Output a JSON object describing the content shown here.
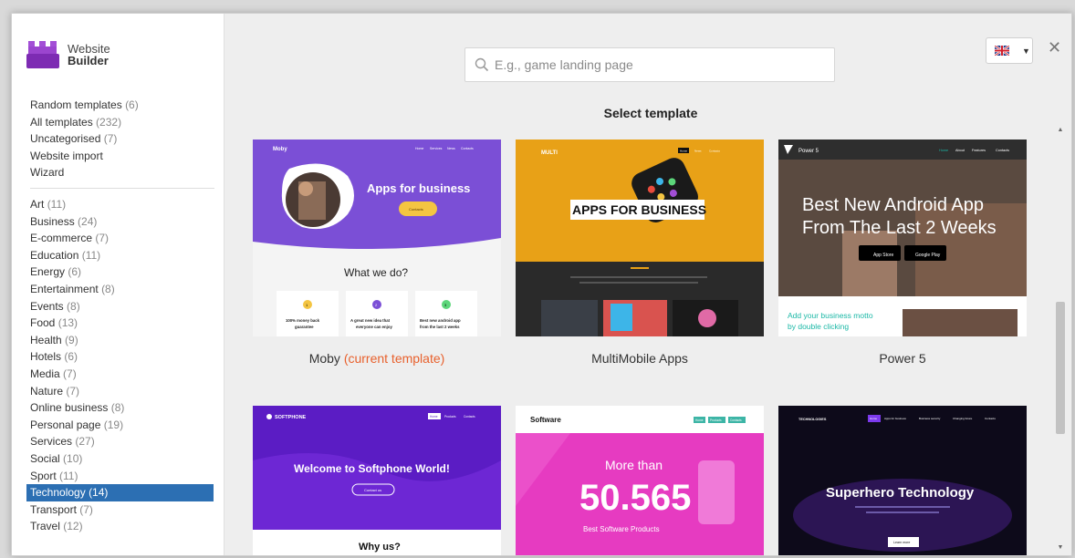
{
  "brand": {
    "line1": "Website",
    "line2": "Builder",
    "color": "#8e3bbf"
  },
  "search": {
    "placeholder": "E.g., game landing page"
  },
  "language": {
    "flag": "uk-flag-icon"
  },
  "header": {
    "title": "Select template"
  },
  "sidebar": {
    "top_items": [
      {
        "label": "Random templates",
        "count": "(6)"
      },
      {
        "label": "All templates",
        "count": "(232)"
      },
      {
        "label": "Uncategorised",
        "count": "(7)"
      },
      {
        "label": "Website import",
        "count": ""
      },
      {
        "label": "Wizard",
        "count": ""
      }
    ],
    "categories": [
      {
        "label": "Art",
        "count": "(11)"
      },
      {
        "label": "Business",
        "count": "(24)"
      },
      {
        "label": "E-commerce",
        "count": "(7)"
      },
      {
        "label": "Education",
        "count": "(11)"
      },
      {
        "label": "Energy",
        "count": "(6)"
      },
      {
        "label": "Entertainment",
        "count": "(8)"
      },
      {
        "label": "Events",
        "count": "(8)"
      },
      {
        "label": "Food",
        "count": "(13)"
      },
      {
        "label": "Health",
        "count": "(9)"
      },
      {
        "label": "Hotels",
        "count": "(6)"
      },
      {
        "label": "Media",
        "count": "(7)"
      },
      {
        "label": "Nature",
        "count": "(7)"
      },
      {
        "label": "Online business",
        "count": "(8)"
      },
      {
        "label": "Personal page",
        "count": "(19)"
      },
      {
        "label": "Services",
        "count": "(27)"
      },
      {
        "label": "Social",
        "count": "(10)"
      },
      {
        "label": "Sport",
        "count": "(11)"
      },
      {
        "label": "Technology",
        "count": "(14)",
        "active": true
      },
      {
        "label": "Transport",
        "count": "(7)"
      },
      {
        "label": "Travel",
        "count": "(12)"
      }
    ],
    "active_color": "#2c6fb3"
  },
  "templates": [
    {
      "name": "Moby",
      "current_suffix": "(current template)",
      "thumb": {
        "logo": "Moby",
        "nav": [
          "Home",
          "Services",
          "News",
          "Contacts"
        ],
        "headline": "Apps for business",
        "button": "Contacts",
        "section_title": "What we do?",
        "features": [
          {
            "badge": "1",
            "text1": "100% money back",
            "text2": "guarantee"
          },
          {
            "badge": "2",
            "text1": "A great new idea that",
            "text2": "everyone can enjoy"
          },
          {
            "badge": "3",
            "text1": "Best new android app",
            "text2": "from the last 2 weeks"
          }
        ],
        "accent": "#7b4fd6"
      }
    },
    {
      "name": "MultiMobile Apps",
      "current_suffix": "",
      "thumb": {
        "logo": "MULTI",
        "nav": [
          "Home",
          "News",
          "Contacts"
        ],
        "headline": "APPS FOR BUSINESS",
        "accent": "#e8a117"
      }
    },
    {
      "name": "Power 5",
      "current_suffix": "",
      "thumb": {
        "logo": "Power 5",
        "nav": [
          "Home",
          "About",
          "Features",
          "Contacts"
        ],
        "headline1": "Best New Android App",
        "headline2": "From The Last 2 Weeks",
        "store1": "App Store",
        "store2": "Google Play",
        "motto1": "Add your business motto",
        "motto2": "by double clicking",
        "accent": "#1bb8a6"
      }
    },
    {
      "name": "",
      "current_suffix": "",
      "thumb": {
        "logo": "SOFTPHONE",
        "nav": [
          "Home",
          "Products",
          "Contacts"
        ],
        "headline": "Welcome to Softphone World!",
        "button": "Contact us",
        "section_title": "Why us?",
        "accent": "#6a1fd1"
      }
    },
    {
      "name": "",
      "current_suffix": "",
      "thumb": {
        "logo": "Software",
        "nav": [
          "Home",
          "Products",
          "Contacts"
        ],
        "headline1": "More than",
        "number": "50.565",
        "subline": "Best Software Products",
        "accent": "#e63bc1"
      }
    },
    {
      "name": "",
      "current_suffix": "",
      "thumb": {
        "logo": "TECHNOLOGIES",
        "nav": [
          "Home",
          "Apps for business",
          "Business security",
          "Changing future",
          "Contacts"
        ],
        "headline": "Superhero Technology",
        "button": "Learn more",
        "accent": "#7c3aed"
      }
    }
  ]
}
